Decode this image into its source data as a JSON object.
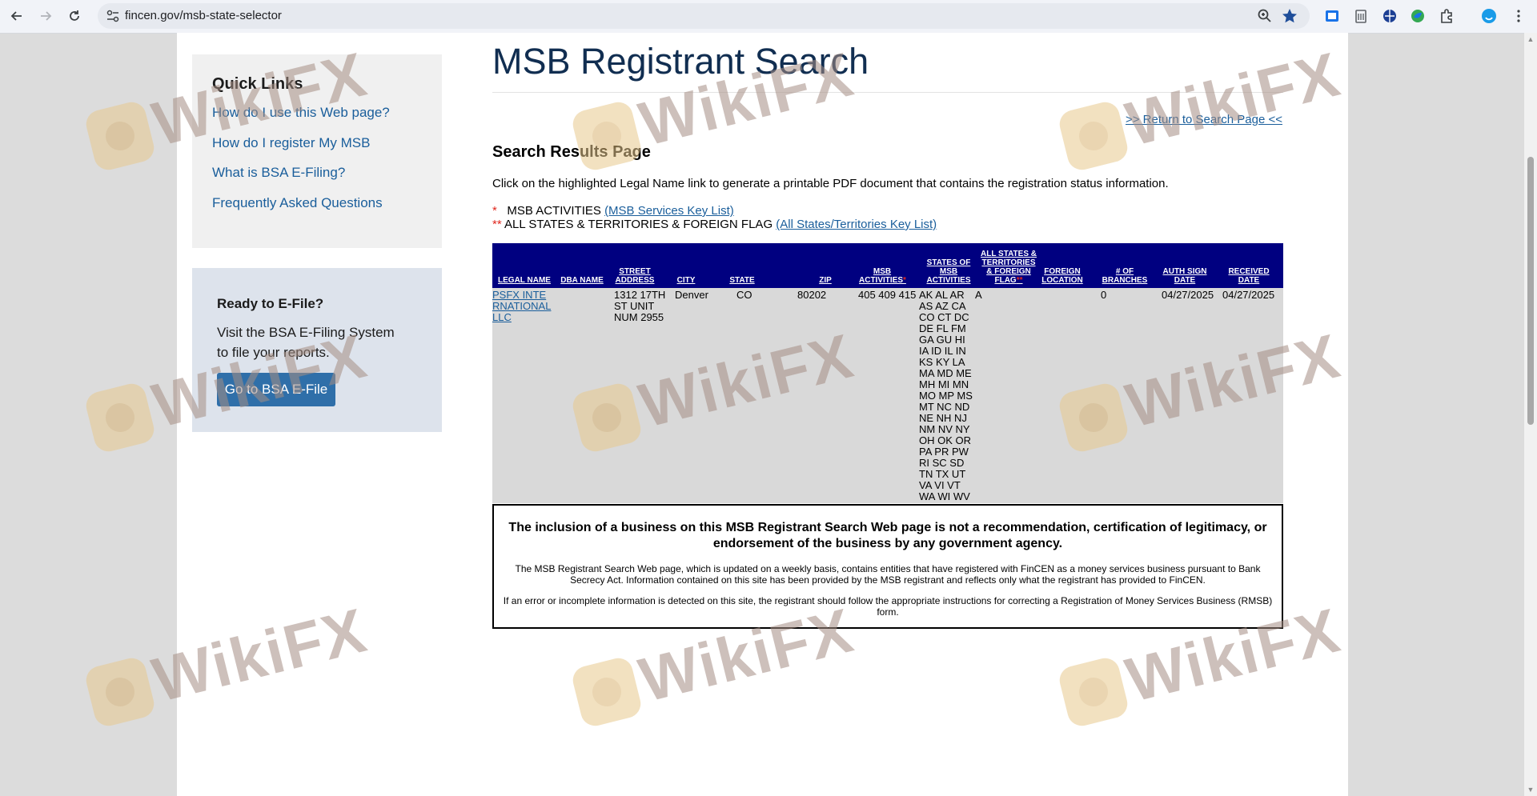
{
  "browser": {
    "url": "fincen.gov/msb-state-selector"
  },
  "sidebar": {
    "quick_links_title": "Quick Links",
    "links": [
      "How do I use this Web page?",
      "How do I register My MSB",
      "What is BSA E-Filing?",
      "Frequently Asked Questions"
    ],
    "efile_title": "Ready to E-File?",
    "efile_text": "Visit the BSA E-Filing System to file your reports.",
    "efile_button": "Go to BSA E-File"
  },
  "main": {
    "title": "MSB Registrant Search",
    "return_link": ">> Return to Search Page <<",
    "results_heading": "Search Results Page",
    "instructions": "Click on the highlighted Legal Name link to generate a printable PDF document that contains the registration status information.",
    "key1_star": "*",
    "key1_text": "MSB ACTIVITIES",
    "key1_link": "(MSB Services Key List)",
    "key2_star": "**",
    "key2_text": "ALL STATES & TERRITORIES & FOREIGN FLAG",
    "key2_link": "(All States/Territories Key List)"
  },
  "table": {
    "headers": {
      "legal_name": "LEGAL NAME",
      "dba_name": "DBA NAME",
      "street_address": "STREET ADDRESS",
      "city": "CITY",
      "state": "STATE",
      "zip": "ZIP",
      "msb_activities": "MSB ACTIVITIES",
      "msb_activities_mark": "*",
      "states_of_msb_activities": "STATES OF MSB ACTIVITIES",
      "all_states": "ALL STATES & TERRITORIES & FOREIGN FLAG",
      "all_states_mark": "**",
      "foreign_location": "FOREIGN LOCATION",
      "branches": "# OF BRANCHES",
      "auth_sign_date": "AUTH SIGN DATE",
      "received_date": "RECEIVED DATE"
    },
    "row": {
      "legal_name": "PSFX INTERNATIONAL LLC",
      "dba_name": "",
      "street_address": "1312 17TH ST UNIT NUM 2955",
      "city": "Denver",
      "state": "CO",
      "zip": "80202",
      "msb_activities": "405 409 415",
      "states": "AK AL AR AS AZ CA CO CT DC DE FL FM GA GU HI IA ID IL IN KS KY LA MA MD ME MH MI MN MO MP MS MT NC ND NE NH NJ NM NV NY OH OK OR PA PR PW RI SC SD TN TX UT VA VI VT WA WI WV WY",
      "all_states": "A",
      "foreign_location": "",
      "branches": "0",
      "auth_sign_date": "04/27/2025",
      "received_date": "04/27/2025"
    }
  },
  "disclaimer": {
    "heading": "The inclusion of a business on this MSB Registrant Search Web page is not a recommendation, certification of legitimacy, or endorsement of the business by any government agency.",
    "p1": "The MSB Registrant Search Web page, which is updated on a weekly basis, contains entities that have registered with FinCEN as a money services business pursuant to Bank Secrecy Act. Information contained on this site has been provided by the MSB registrant and reflects only what the registrant has provided to FinCEN.",
    "p2": "If an error or incomplete information is detected on this site, the registrant should follow the appropriate instructions for correcting a Registration of Money Services Business (RMSB) form."
  },
  "watermark": {
    "text": "WikiFX"
  }
}
